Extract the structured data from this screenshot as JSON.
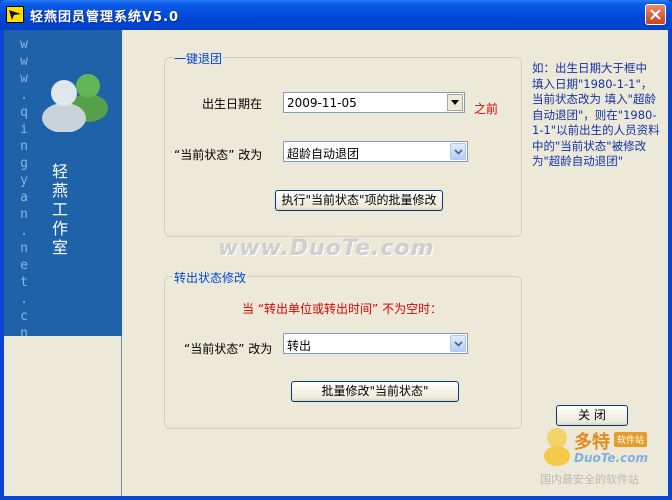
{
  "window": {
    "title": "轻燕团员管理系统V5.0",
    "icons": {
      "app": "swallow-icon",
      "close": "close-icon"
    }
  },
  "banner": {
    "url_text": "www.qingyan.net.cn",
    "studio_text": "轻燕工作室",
    "icon": "people-icon"
  },
  "retire_group": {
    "title": "一键退团",
    "birth_label": "出生日期在",
    "birth_value": "2009-11-05",
    "before_label": "之前",
    "status_label": "“当前状态” 改为",
    "status_value": "超龄自动退团",
    "execute_button": "执行\"当前状态\"项的批量修改"
  },
  "hint": {
    "text": "如：出生日期大于框中 填入日期\"1980-1-1\"，当前状态改为 填入\"超龄自动退团\"，则在\"1980-1-1\"以前出生的人员资料中的\"当前状态\"被修改为\"超龄自动退团\""
  },
  "transfer_group": {
    "title": "转出状态修改",
    "condition": "当 “转出单位或转出时间” 不为空时：",
    "status_label": "“当前状态” 改为",
    "status_value": "转出",
    "batch_button": "批量修改\"当前状态\""
  },
  "close_button": "关 闭",
  "watermark": "www.DuoTe.com",
  "logo": {
    "main": "多特",
    "small": "软件站",
    "domain": "DuoTe.com",
    "slogan": "国内最安全的软件站"
  },
  "colors": {
    "title_bar": "#0046d6",
    "banner": "#1e62a9",
    "group_title": "#0046d5",
    "warning_red": "#e00000",
    "hint_blue": "#1232a8"
  }
}
